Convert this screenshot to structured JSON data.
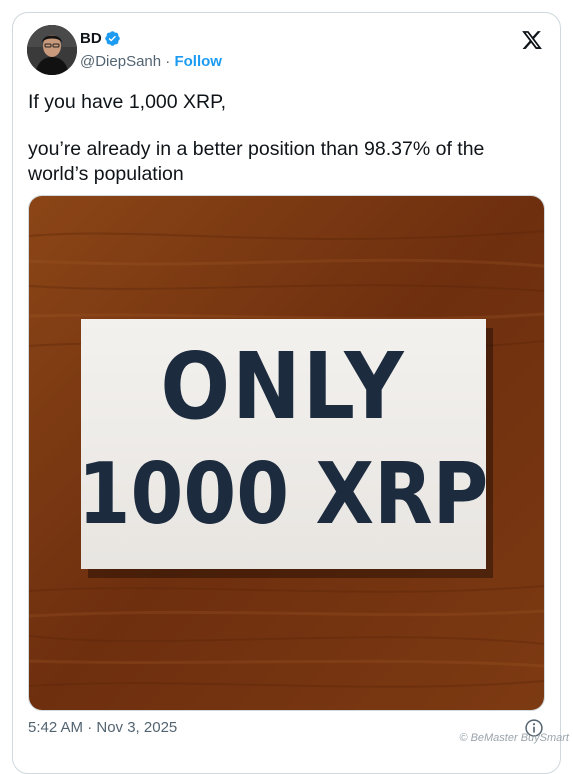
{
  "author": {
    "name": "BD",
    "handle": "@DiepSanh",
    "separator": "·",
    "follow_label": "Follow"
  },
  "tweet": {
    "line1": "If you have 1,000 XRP,",
    "line2": "you’re already in a better position than 98.37% of the world’s population",
    "timestamp": "5:42 AM · Nov 3, 2025"
  },
  "media": {
    "card_line1": "ONLY",
    "card_line2": "1000 XRP"
  },
  "watermark": "© BeMaster BuySmart",
  "icons": {
    "platform_logo": "x-logo-icon",
    "verified": "verified-badge-icon",
    "info": "info-icon"
  },
  "colors": {
    "accent": "#1d9bf0",
    "card_text": "#1c2b3e",
    "wood": "#7a3a16"
  }
}
